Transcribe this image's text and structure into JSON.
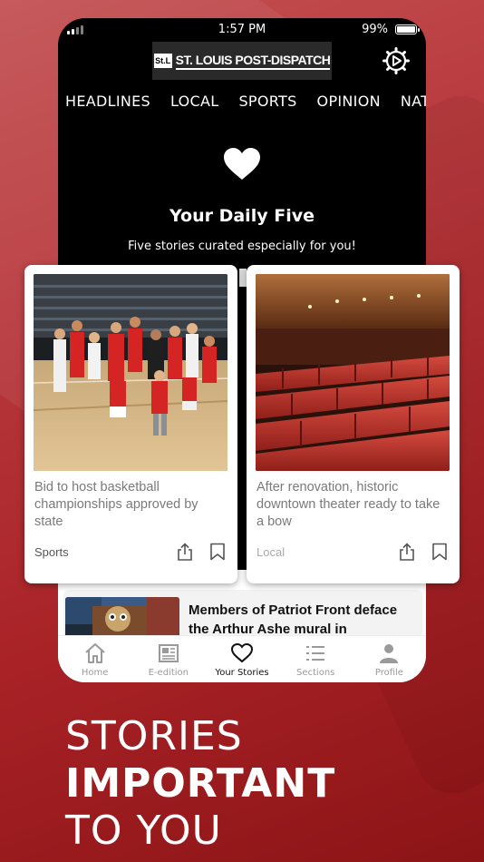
{
  "status_bar": {
    "time": "1:57 PM",
    "battery": "99%"
  },
  "app": {
    "logo_mark": "St.L",
    "logo_text": "ST. LOUIS POST-DISPATCH"
  },
  "nav_tabs": [
    "HEADLINES",
    "LOCAL",
    "SPORTS",
    "OPINION",
    "NATION"
  ],
  "daily": {
    "title": "Your Daily Five",
    "subtitle": "Five stories curated especially for you!"
  },
  "cards": [
    {
      "headline": "Bid to host basketball championships approved by state",
      "section": "Sports"
    },
    {
      "headline": "After renovation, historic downtown theater ready to take a bow",
      "section": "Local"
    }
  ],
  "list_item": {
    "headline": "Members of Patriot Front deface the Arthur Ashe mural in"
  },
  "tabbar": [
    {
      "label": "Home",
      "icon": "home-icon"
    },
    {
      "label": "E-edition",
      "icon": "newspaper-icon"
    },
    {
      "label": "Your Stories",
      "icon": "heart-icon"
    },
    {
      "label": "Sections",
      "icon": "list-icon"
    },
    {
      "label": "Profile",
      "icon": "person-icon"
    }
  ],
  "tagline": {
    "line1": "STORIES",
    "line2": "IMPORTANT",
    "line3": "TO YOU"
  },
  "colors": {
    "background": "#a82226",
    "accent": "#000000",
    "tab_active": "#111111",
    "tab_inactive": "#9a9a9a"
  }
}
